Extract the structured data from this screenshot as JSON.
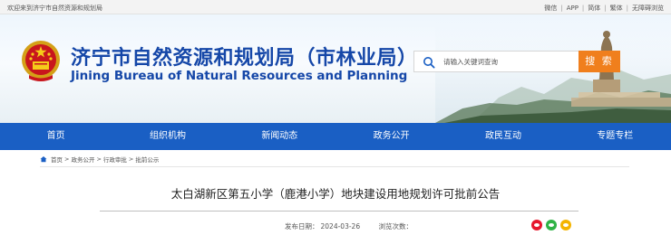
{
  "topbar": {
    "welcome": "欢迎来到济宁市自然资源和规划局",
    "links": [
      "微信",
      "APP",
      "简体",
      "繁体",
      "无障碍浏览"
    ]
  },
  "header": {
    "title_cn": "济宁市自然资源和规划局（市林业局）",
    "title_en": "Jining Bureau of Natural Resources and Planning"
  },
  "search": {
    "placeholder": "请输入关键词查询",
    "button": "搜 索"
  },
  "nav": {
    "items": [
      "首页",
      "组织机构",
      "新闻动态",
      "政务公开",
      "政民互动",
      "专题专栏"
    ]
  },
  "breadcrumb": [
    "首页",
    "政务公开",
    "行政审批",
    "批前公示"
  ],
  "article": {
    "title": "太白湖新区第五小学（鹿港小学）地块建设用地规划许可批前公告",
    "date_label": "发布日期：",
    "date": "2024-03-26",
    "views_label": "浏览次数："
  },
  "colors": {
    "primary": "#1a5fc4",
    "title_blue": "#1547a8",
    "search_button": "#f07f1d"
  }
}
